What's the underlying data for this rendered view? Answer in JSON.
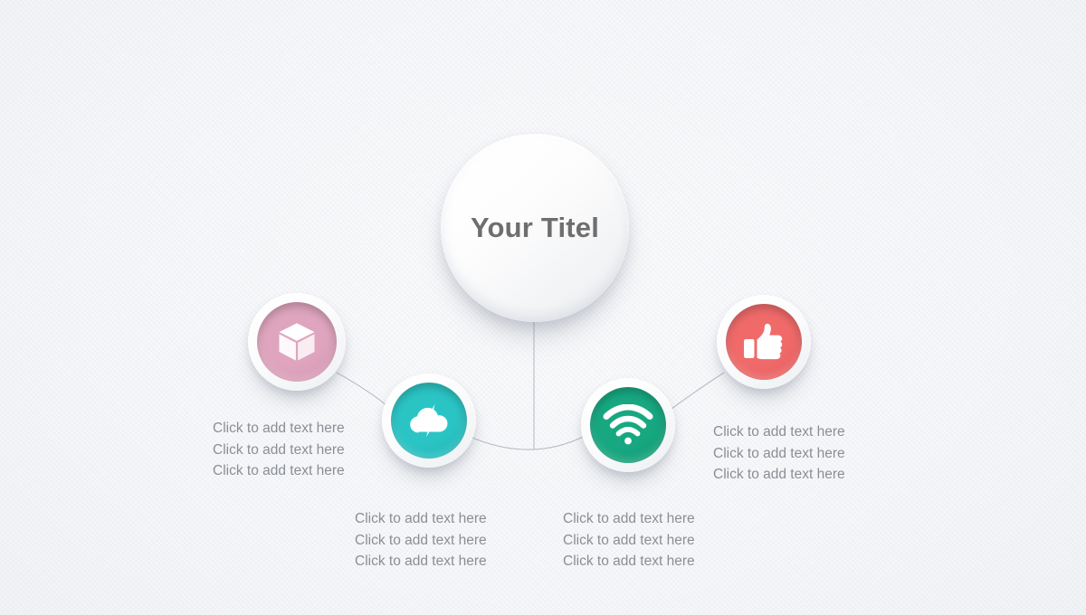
{
  "slide": {
    "title": "Your Titel",
    "background_color": "#F5F6F8",
    "title_color": "#6E6E6E",
    "text_color": "#8A8E95",
    "connector_color": "#B9BDC4"
  },
  "nodes": [
    {
      "id": "cube",
      "icon": "cube-icon",
      "color": "#DFA5BE",
      "color_dark": "#D394AF",
      "text_align": "right",
      "lines": [
        "Click to add text here",
        "Click to add text here",
        "Click to add text here"
      ]
    },
    {
      "id": "cloud",
      "icon": "cloud-lightning-icon",
      "color": "#2BC4C4",
      "color_dark": "#22B4B4",
      "text_align": "right",
      "lines": [
        "Click to add text here",
        "Click to add text here",
        "Click to add text here"
      ]
    },
    {
      "id": "wifi",
      "icon": "wifi-icon",
      "color": "#17A881",
      "color_dark": "#139872",
      "text_align": "left",
      "lines": [
        "Click to add text here",
        "Click to add text here",
        "Click to add text here"
      ]
    },
    {
      "id": "thumb",
      "icon": "thumbs-up-icon",
      "color": "#F06A6A",
      "color_dark": "#E45D5D",
      "text_align": "left",
      "lines": [
        "Click to add text here",
        "Click to add text here",
        "Click to add text here"
      ]
    }
  ]
}
